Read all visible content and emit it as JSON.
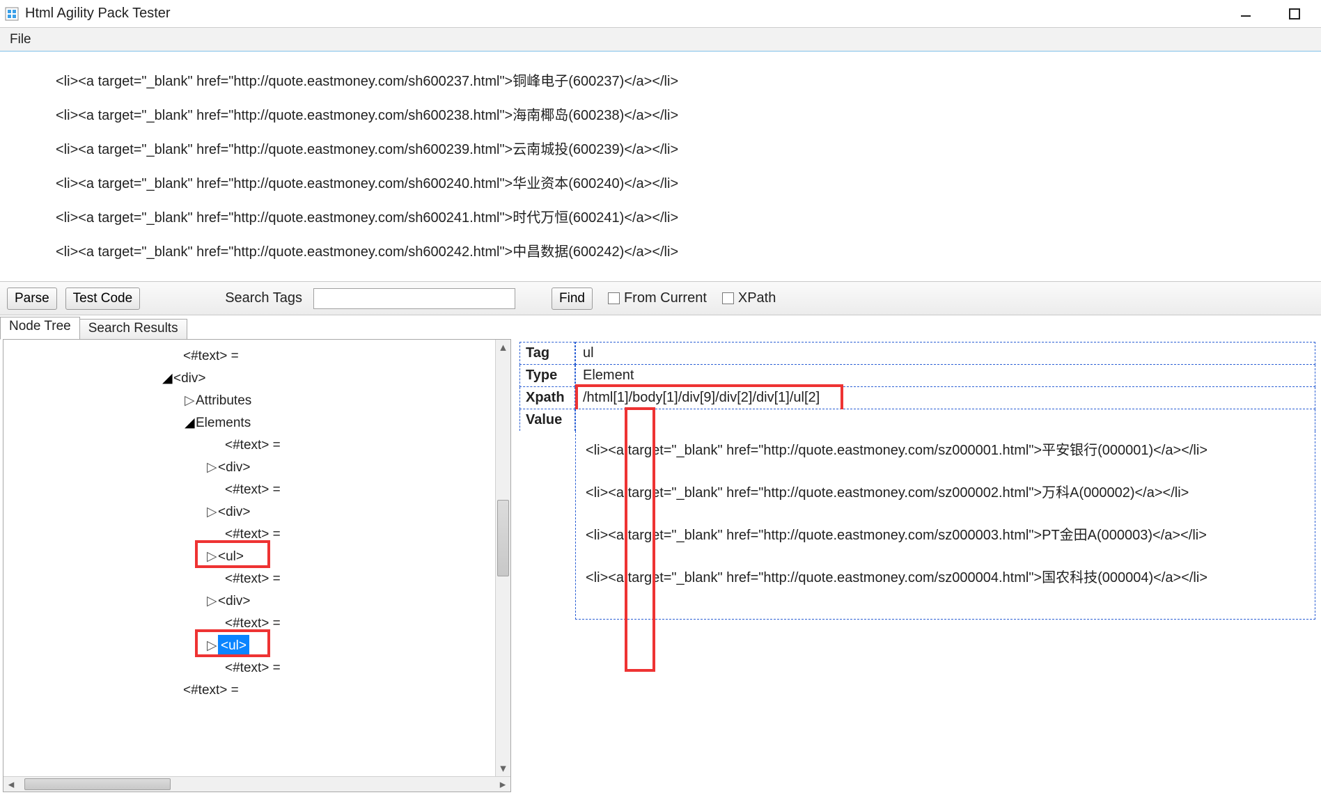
{
  "window": {
    "title": "Html Agility Pack Tester"
  },
  "menu": {
    "file": "File"
  },
  "html_lines": [
    "<li><a target=\"_blank\" href=\"http://quote.eastmoney.com/sh600237.html\">铜峰电子(600237)</a></li>",
    "<li><a target=\"_blank\" href=\"http://quote.eastmoney.com/sh600238.html\">海南椰岛(600238)</a></li>",
    "<li><a target=\"_blank\" href=\"http://quote.eastmoney.com/sh600239.html\">云南城投(600239)</a></li>",
    "<li><a target=\"_blank\" href=\"http://quote.eastmoney.com/sh600240.html\">华业资本(600240)</a></li>",
    "<li><a target=\"_blank\" href=\"http://quote.eastmoney.com/sh600241.html\">时代万恒(600241)</a></li>",
    "<li><a target=\"_blank\" href=\"http://quote.eastmoney.com/sh600242.html\">中昌数据(600242)</a></li>"
  ],
  "toolbar": {
    "parse": "Parse",
    "test_code": "Test Code",
    "search_label": "Search Tags",
    "search_value": "",
    "find": "Find",
    "from_current": "From Current",
    "xpath": "XPath"
  },
  "tabs": {
    "node_tree": "Node Tree",
    "search_results": "Search Results"
  },
  "tree": [
    {
      "indent": 240,
      "arrow": "",
      "text": "<#text>  ="
    },
    {
      "indent": 224,
      "arrow": "▲",
      "text": "<div>"
    },
    {
      "indent": 256,
      "arrow": "▷",
      "text": "Attributes"
    },
    {
      "indent": 256,
      "arrow": "▲",
      "text": "Elements"
    },
    {
      "indent": 300,
      "arrow": "",
      "text": "<#text>  ="
    },
    {
      "indent": 288,
      "arrow": "▷",
      "text": "<div>"
    },
    {
      "indent": 300,
      "arrow": "",
      "text": "<#text>  ="
    },
    {
      "indent": 288,
      "arrow": "▷",
      "text": "<div>"
    },
    {
      "indent": 300,
      "arrow": "",
      "text": "<#text>  ="
    },
    {
      "indent": 288,
      "arrow": "▷",
      "text": "<ul>"
    },
    {
      "indent": 300,
      "arrow": "",
      "text": "<#text>  ="
    },
    {
      "indent": 288,
      "arrow": "▷",
      "text": "<div>"
    },
    {
      "indent": 300,
      "arrow": "",
      "text": "<#text>  ="
    },
    {
      "indent": 288,
      "arrow": "▷",
      "text": "<ul>",
      "selected": true
    },
    {
      "indent": 300,
      "arrow": "",
      "text": "<#text>  ="
    },
    {
      "indent": 240,
      "arrow": "",
      "text": "<#text>  ="
    }
  ],
  "detail": {
    "tag_label": "Tag",
    "tag_value": "ul",
    "type_label": "Type",
    "type_value": "Element",
    "xpath_label": "Xpath",
    "xpath_value": "/html[1]/body[1]/div[9]/div[2]/div[1]/ul[2]",
    "value_label": "Value",
    "value_lines": [
      "<li><a target=\"_blank\" href=\"http://quote.eastmoney.com/sz000001.html\">平安银行(000001)</a></li>",
      "<li><a target=\"_blank\" href=\"http://quote.eastmoney.com/sz000002.html\">万科A(000002)</a></li>",
      "<li><a target=\"_blank\" href=\"http://quote.eastmoney.com/sz000003.html\">PT金田A(000003)</a></li>",
      "<li><a target=\"_blank\" href=\"http://quote.eastmoney.com/sz000004.html\">国农科技(000004)</a></li>"
    ]
  }
}
